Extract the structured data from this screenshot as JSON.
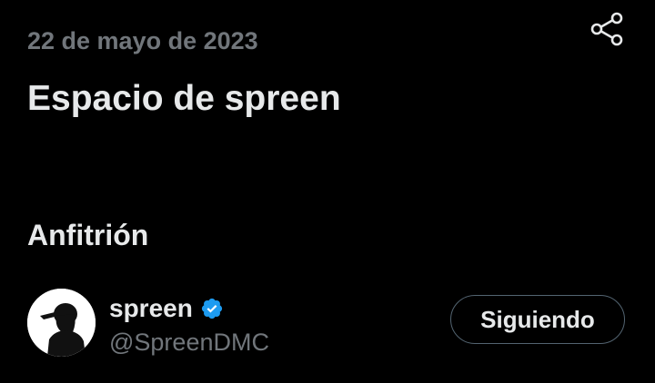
{
  "space": {
    "date": "22 de mayo de 2023",
    "title": "Espacio de spreen"
  },
  "host_section": {
    "label": "Anfitrión",
    "host": {
      "name": "spreen",
      "handle": "@SpreenDMC",
      "verified": true,
      "follow_button_label": "Siguiendo"
    }
  },
  "icons": {
    "share": "share-icon",
    "verified": "verified-badge-icon"
  },
  "colors": {
    "background": "#000000",
    "primary_text": "#e7e9ea",
    "secondary_text": "#71767b",
    "verified_blue": "#1d9bf0",
    "button_border": "#536471"
  }
}
